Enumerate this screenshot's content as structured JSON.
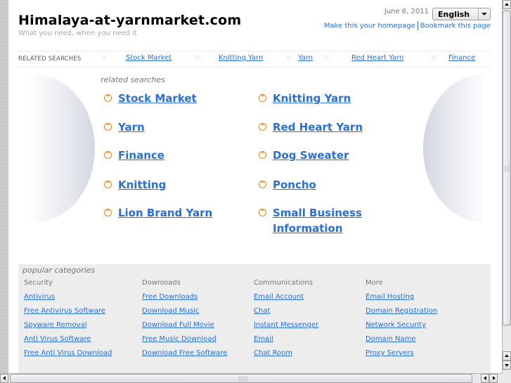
{
  "header": {
    "site_title": "Himalaya-at-yarnmarket.com",
    "tagline": "What you need, when you need it",
    "date": "June 6, 2011",
    "language_selected": "English",
    "homepage_link": "Make this your homepage",
    "bookmark_link": "Bookmark this page"
  },
  "related_bar": {
    "label": "RELATED SEARCHES",
    "separator": "::",
    "links": [
      "Stock Market",
      "Knitting Yarn",
      "Yarn",
      "Red Heart Yarn",
      "Finance"
    ]
  },
  "related_searches": {
    "heading": "related searches",
    "left": [
      "Stock Market",
      "Yarn",
      "Finance",
      "Knitting",
      "Lion Brand Yarn"
    ],
    "right": [
      "Knitting Yarn",
      "Red Heart Yarn",
      "Dog Sweater",
      "Poncho",
      "Small Business",
      "Information"
    ]
  },
  "popular_categories": {
    "heading": "popular categories",
    "columns": [
      {
        "title": "Security",
        "links": [
          "Antivirus",
          "Free Antivirus Software",
          "Spyware Removal",
          "Anti Virus Software",
          "Free Anti Virus Download"
        ]
      },
      {
        "title": "Downloads",
        "links": [
          "Free Downloads",
          "Download Music",
          "Download Full Movie",
          "Free Music Download",
          "Download Free Software"
        ]
      },
      {
        "title": "Communications",
        "links": [
          "Email Account",
          "Chat",
          "Instant Messenger",
          "Email",
          "Chat Room"
        ]
      },
      {
        "title": "More",
        "links": [
          "Email Hosting",
          "Domain Registration",
          "Network Security",
          "Domain Name",
          "Proxy Servers"
        ]
      }
    ]
  }
}
